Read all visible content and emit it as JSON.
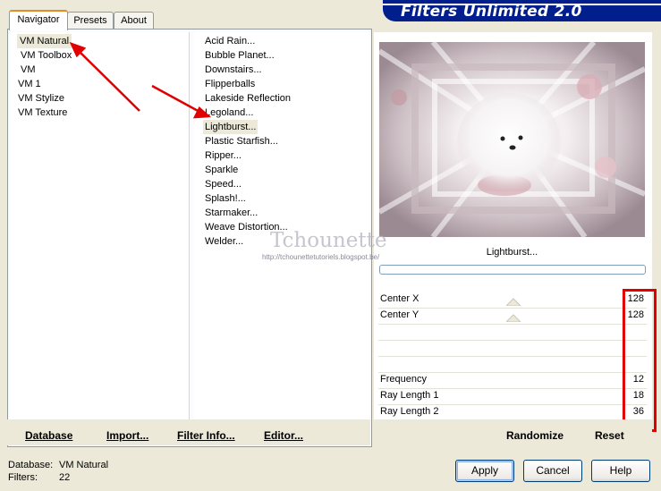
{
  "banner": {
    "title": "Filters Unlimited 2.0"
  },
  "tabs": [
    {
      "label": "Navigator",
      "active": true
    },
    {
      "label": "Presets",
      "active": false
    },
    {
      "label": "About",
      "active": false
    }
  ],
  "categories": [
    "VM Natural",
    "VM Toolbox",
    "VM",
    "VM 1",
    "VM Stylize",
    "VM Texture"
  ],
  "selected_category": "VM Natural",
  "filters": [
    "Acid Rain...",
    "Bubble Planet...",
    "Downstairs...",
    "Flipperballs",
    "Lakeside Reflection",
    "Legoland...",
    "Lightburst...",
    "Plastic Starfish...",
    "Ripper...",
    "Sparkle",
    "Speed...",
    "Splash!...",
    "Starmaker...",
    "Weave Distortion...",
    "Welder..."
  ],
  "selected_filter": "Lightburst...",
  "preview": {
    "filter_label": "Lightburst..."
  },
  "watermark": {
    "text": "Tchounette",
    "url": "http://tchounettetutoriels.blogspot.be/"
  },
  "params": [
    {
      "label": "Center X",
      "value": "128",
      "slider": 0.5
    },
    {
      "label": "Center Y",
      "value": "128",
      "slider": 0.5
    },
    {
      "label": "",
      "value": ""
    },
    {
      "label": "",
      "value": ""
    },
    {
      "label": "",
      "value": ""
    },
    {
      "label": "Frequency",
      "value": "12"
    },
    {
      "label": "Ray Length 1",
      "value": "18"
    },
    {
      "label": "Ray Length 2",
      "value": "36"
    }
  ],
  "toolbar": {
    "database": "Database",
    "import": "Import...",
    "filter_info": "Filter Info...",
    "editor": "Editor...",
    "randomize": "Randomize",
    "reset": "Reset"
  },
  "status": {
    "database_label": "Database:",
    "database_value": "VM Natural",
    "filters_label": "Filters:",
    "filters_value": "22"
  },
  "buttons": {
    "apply": "Apply",
    "cancel": "Cancel",
    "help": "Help"
  },
  "colors": {
    "banner": "#001e8c",
    "highlight": "#e00000",
    "tab_accent": "#e68b2c"
  }
}
